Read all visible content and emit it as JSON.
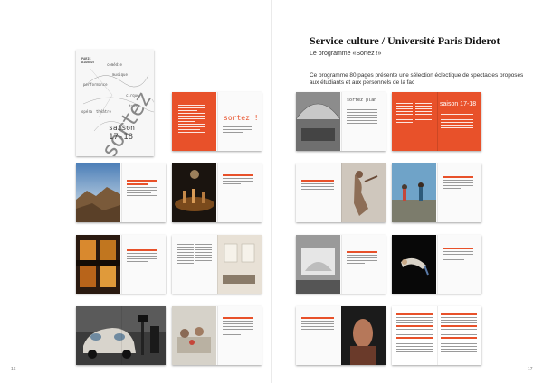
{
  "header": {
    "title": "Service culture / Université Paris Diderot",
    "subtitle": "Le programme «Sortez !»",
    "description_line1": "Ce programme 80 pages présente une sélection éclectique de spectacles proposés",
    "description_line2": "aux étudiants et aux personnels de la fac"
  },
  "cover": {
    "publisher": "PARIS DIDEROT",
    "word_big": "sortez !",
    "season": "saison",
    "years": "17-18",
    "genres": [
      "comédie",
      "musique",
      "performance",
      "cirque",
      "danse",
      "opéra",
      "théâtre"
    ]
  },
  "spread_labels": {
    "sortez": "sortez !",
    "saison": "saison 17-18",
    "sortez_plan": "sortez plan"
  },
  "folios": {
    "left": "16",
    "right": "17"
  },
  "colors": {
    "accent": "#e8512a",
    "background": "#ffffff"
  }
}
